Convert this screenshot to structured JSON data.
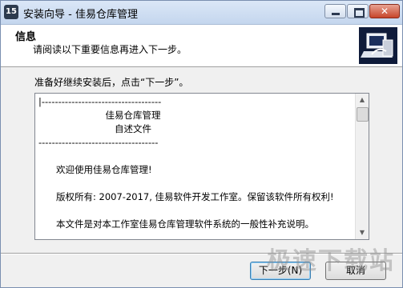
{
  "window": {
    "title": "安装向导 - 佳易仓库管理",
    "app_icon_text": "15"
  },
  "header": {
    "title": "信息",
    "subtitle": "请阅读以下重要信息再进入下一步。",
    "logo_icon": "installer-computer-icon"
  },
  "instruction": "准备好继续安装后，点击“下一步”。",
  "readme": {
    "lines": [
      "|------------------------------------",
      "佳易仓库管理",
      "自述文件",
      "------------------------------------",
      "",
      "欢迎使用佳易仓库管理!",
      "",
      "版权所有: 2007-2017, 佳易软件开发工作室。保留该软件所有权利!",
      "",
      "本文件是对本工作室佳易仓库管理软件系统的一般性补充说明。"
    ]
  },
  "buttons": {
    "next": "下一步(N)",
    "cancel": "取消"
  },
  "watermark": "极速下载站",
  "colors": {
    "titlebar": "#c4d6ee",
    "close_button": "#c7452a",
    "logo_bg": "#0f1b3a"
  }
}
